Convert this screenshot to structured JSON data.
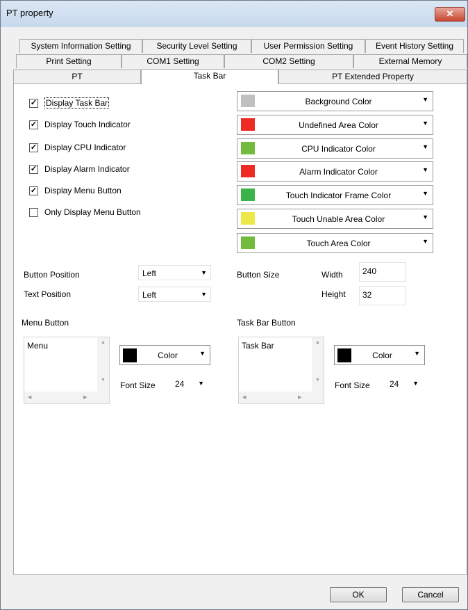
{
  "window": {
    "title": "PT property",
    "close_label": "✕"
  },
  "tabs": {
    "row1": [
      "System Information Setting",
      "Security Level Setting",
      "User Permission Setting",
      "Event History Setting"
    ],
    "row2": [
      "Print Setting",
      "COM1 Setting",
      "COM2 Setting",
      "External Memory"
    ],
    "row3": [
      "PT",
      "Task Bar",
      "PT Extended Property"
    ],
    "active": "Task Bar"
  },
  "checkboxes": [
    {
      "label": "Display Task Bar",
      "checked": true,
      "mark": "✓"
    },
    {
      "label": "Display Touch Indicator",
      "checked": true,
      "mark": "✓"
    },
    {
      "label": "Display CPU Indicator",
      "checked": true,
      "mark": "✓"
    },
    {
      "label": "Display Alarm Indicator",
      "checked": true,
      "mark": "✓"
    },
    {
      "label": "Display Menu Button",
      "checked": true,
      "mark": "✓"
    },
    {
      "label": "Only Display Menu Button",
      "checked": false,
      "mark": ""
    }
  ],
  "color_dropdowns": [
    {
      "label": "Background Color",
      "color": "#c0c0c0"
    },
    {
      "label": "Undefined Area Color",
      "color": "#ee2a24"
    },
    {
      "label": "CPU Indicator Color",
      "color": "#73bb3f"
    },
    {
      "label": "Alarm Indicator Color",
      "color": "#ee2a24"
    },
    {
      "label": "Touch Indicator Frame Color",
      "color": "#3cb34a"
    },
    {
      "label": "Touch Unable Area Color",
      "color": "#ece84a"
    },
    {
      "label": "Touch Area Color",
      "color": "#73bb3f"
    }
  ],
  "positions": {
    "button_position_label": "Button Position",
    "button_position_value": "Left",
    "text_position_label": "Text Position",
    "text_position_value": "Left"
  },
  "button_size": {
    "label": "Button Size",
    "width_label": "Width",
    "width_value": "240",
    "height_label": "Height",
    "height_value": "32"
  },
  "menu_button": {
    "section_label": "Menu Button",
    "text": "Menu",
    "color_label": "Color",
    "font_size_label": "Font Size",
    "font_size_value": "24"
  },
  "task_bar_button": {
    "section_label": "Task Bar Button",
    "text": "Task Bar",
    "color_label": "Color",
    "font_size_label": "Font Size",
    "font_size_value": "24"
  },
  "footer": {
    "ok_label": "OK",
    "cancel_label": "Cancel"
  },
  "glyphs": {
    "dropdown_arrow": "▼",
    "scroll_up": "▲",
    "scroll_down": "▼",
    "scroll_left": "◀",
    "scroll_right": "▶"
  }
}
